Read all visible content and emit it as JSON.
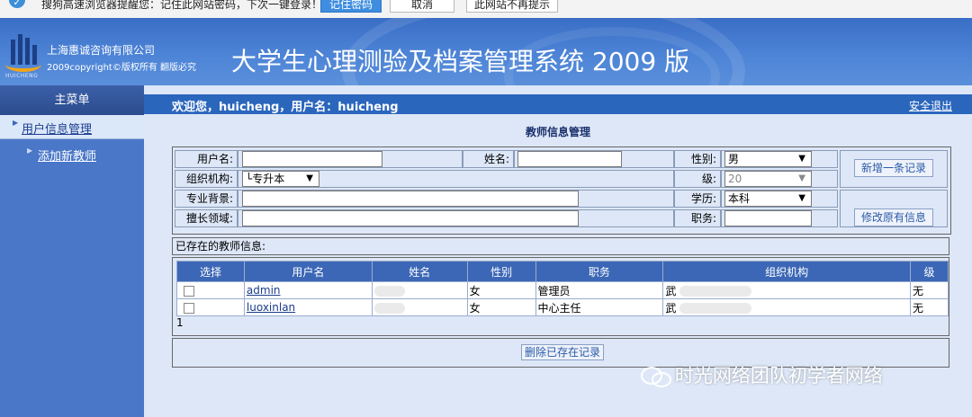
{
  "notify": {
    "message": "搜狗高速浏览器提醒您：记住此网站密码，下次一键登录！",
    "remember_btn": "记住密码",
    "cancel_btn": "取消",
    "never_btn": "此网站不再提示"
  },
  "header": {
    "logo_sub": "HUICHENG",
    "company": "上海惠诚咨询有限公司",
    "copyright": "2009copyright©版权所有 翻版必究",
    "system_title": "大学生心理测验及档案管理系统 2009 版"
  },
  "sidebar": {
    "menu_title": "主菜单",
    "section_label": "用户信息管理",
    "item_label": "添加新教师"
  },
  "welcome": {
    "text": "欢迎您，huicheng，用户名：huicheng",
    "logout": "安全退出"
  },
  "page_title": "教师信息管理",
  "form": {
    "username_label": "用户名:",
    "name_label": "姓名:",
    "gender_label": "性别:",
    "gender_value": "男",
    "org_label": "组织机构:",
    "org_value": "└专升本",
    "level_label": "级:",
    "level_value": "20",
    "major_label": "专业背景:",
    "education_label": "学历:",
    "education_value": "本科",
    "expertise_label": "擅长领域:",
    "position_label": "职务:",
    "add_btn": "新增一条记录",
    "modify_btn": "修改原有信息"
  },
  "existing_label": "已存在的教师信息:",
  "table": {
    "headers": [
      "选择",
      "用户名",
      "姓名",
      "性别",
      "职务",
      "组织机构",
      "级"
    ],
    "rows": [
      {
        "username": "admin",
        "gender": "女",
        "position": "管理员",
        "org": "武",
        "level": "无"
      },
      {
        "username": "luoxinlan",
        "gender": "女",
        "position": "中心主任",
        "org": "武",
        "level": "无"
      }
    ],
    "count": "1"
  },
  "delete_btn": "删除已存在记录",
  "watermark": "时光网络团队初学者网络",
  "colors": {
    "header_blue": "#4d84d6",
    "sidebar_blue": "#4a77c8",
    "welcome_bar": "#2b66bd",
    "table_header": "#3c67b6",
    "main_bg": "#dde7f7"
  }
}
